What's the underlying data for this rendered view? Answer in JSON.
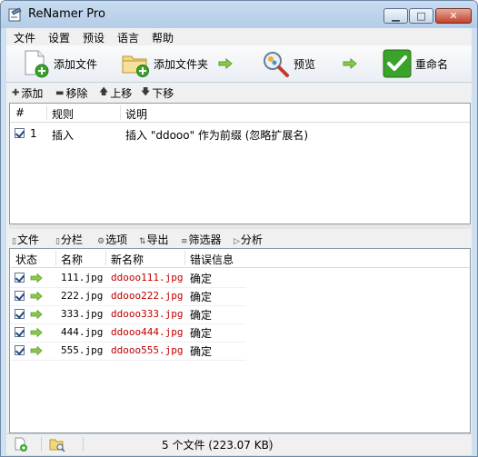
{
  "window": {
    "title": "ReNamer Pro",
    "controls": {
      "minimize": "▁",
      "maximize": "□",
      "close": "✕"
    }
  },
  "menu": [
    "文件",
    "设置",
    "预设",
    "语言",
    "帮助"
  ],
  "toolbar": {
    "add_files": "添加文件",
    "add_folders": "添加文件夹",
    "preview": "预览",
    "rename": "重命名"
  },
  "rules_toolbar": {
    "add": "添加",
    "remove": "移除",
    "move_up": "上移",
    "move_down": "下移"
  },
  "rules_table": {
    "headers": {
      "index": "#",
      "rule": "规则",
      "description": "说明"
    },
    "rows": [
      {
        "checked": true,
        "index": "1",
        "rule": "插入",
        "description": "插入 \"ddooo\" 作为前缀 (忽略扩展名)"
      }
    ]
  },
  "files_tabs": {
    "files": "文件",
    "columns": "分栏",
    "options": "选项",
    "export": "导出",
    "filters": "筛选器",
    "analyze": "分析"
  },
  "files_table": {
    "headers": {
      "status": "状态",
      "name": "名称",
      "new_name": "新名称",
      "error": "错误信息"
    },
    "rows": [
      {
        "checked": true,
        "name": "111.jpg",
        "new_name": "ddooo111.jpg",
        "error": "确定"
      },
      {
        "checked": true,
        "name": "222.jpg",
        "new_name": "ddooo222.jpg",
        "error": "确定"
      },
      {
        "checked": true,
        "name": "333.jpg",
        "new_name": "ddooo333.jpg",
        "error": "确定"
      },
      {
        "checked": true,
        "name": "444.jpg",
        "new_name": "ddooo444.jpg",
        "error": "确定"
      },
      {
        "checked": true,
        "name": "555.jpg",
        "new_name": "ddooo555.jpg",
        "error": "确定"
      }
    ]
  },
  "statusbar": {
    "summary": "5 个文件 (223.07 KB)"
  },
  "colors": {
    "new_name": "#c00000",
    "accent_green": "#3aa32a"
  }
}
